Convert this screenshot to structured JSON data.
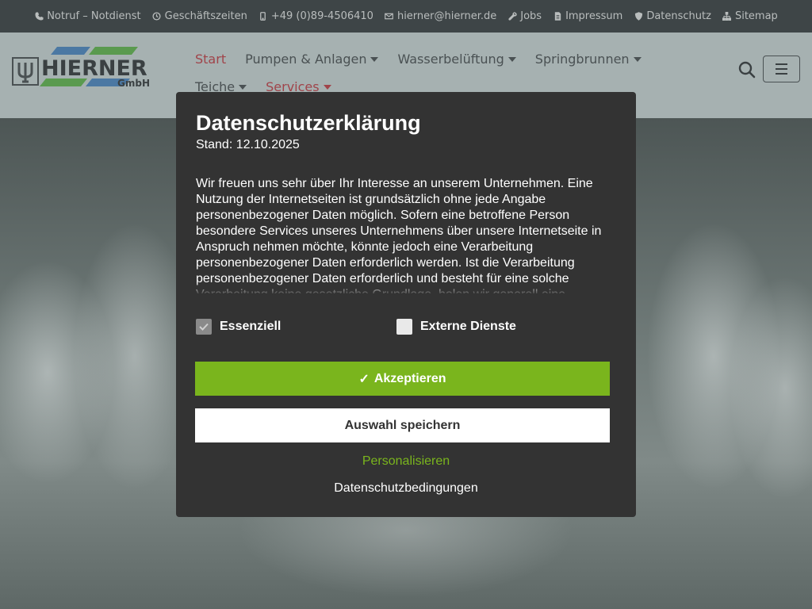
{
  "topbar": {
    "items": [
      {
        "icon": "phone-icon",
        "label": "Notruf – Notdienst"
      },
      {
        "icon": "clock-icon",
        "label": "Geschäftszeiten"
      },
      {
        "icon": "mobile-icon",
        "label": "+49 (0)89-4506410"
      },
      {
        "icon": "envelope-icon",
        "label": "hierner@hierner.de"
      },
      {
        "icon": "wrench-icon",
        "label": "Jobs"
      },
      {
        "icon": "document-icon",
        "label": "Impressum"
      },
      {
        "icon": "shield-icon",
        "label": "Datenschutz"
      },
      {
        "icon": "sitemap-icon",
        "label": "Sitemap"
      }
    ]
  },
  "header": {
    "logo_text": "HIERNER",
    "logo_subtext": "GmbH",
    "nav": [
      {
        "label": "Start",
        "active": true,
        "dropdown": false
      },
      {
        "label": "Pumpen & Anlagen",
        "active": false,
        "dropdown": true
      },
      {
        "label": "Wasserbelüftung",
        "active": false,
        "dropdown": true
      },
      {
        "label": "Springbrunnen",
        "active": false,
        "dropdown": true
      },
      {
        "label": "Teiche",
        "active": false,
        "dropdown": true
      },
      {
        "label": "Services",
        "active": true,
        "dropdown": true
      }
    ]
  },
  "modal": {
    "title": "Datenschutzerklärung",
    "date": "Stand: 12.10.2025",
    "text": "Wir freuen uns sehr über Ihr Interesse an unserem Unternehmen. Eine Nutzung der Internetseiten ist grundsätzlich ohne jede Angabe personenbezogener Daten möglich. Sofern eine betroffene Person besondere Services unseres Unternehmens über unsere Internetseite in Anspruch nehmen möchte, könnte jedoch eine Verarbeitung personenbezogener Daten erforderlich werden. Ist die Verarbeitung personenbezogener Daten erforderlich und besteht für eine solche Verarbeitung keine gesetzliche Grundlage, holen wir generell eine",
    "checkboxes": [
      {
        "label": "Essenziell",
        "checked": true
      },
      {
        "label": "Externe Dienste",
        "checked": false
      }
    ],
    "accept_label": "Akzeptieren",
    "save_label": "Auswahl speichern",
    "personalize_label": "Personalisieren",
    "privacy_link_label": "Datenschutzbedingungen"
  },
  "colors": {
    "accent_green": "#7ab51d",
    "nav_active": "#a0444a",
    "modal_bg": "#333333",
    "topbar_bg": "#3e4547"
  }
}
